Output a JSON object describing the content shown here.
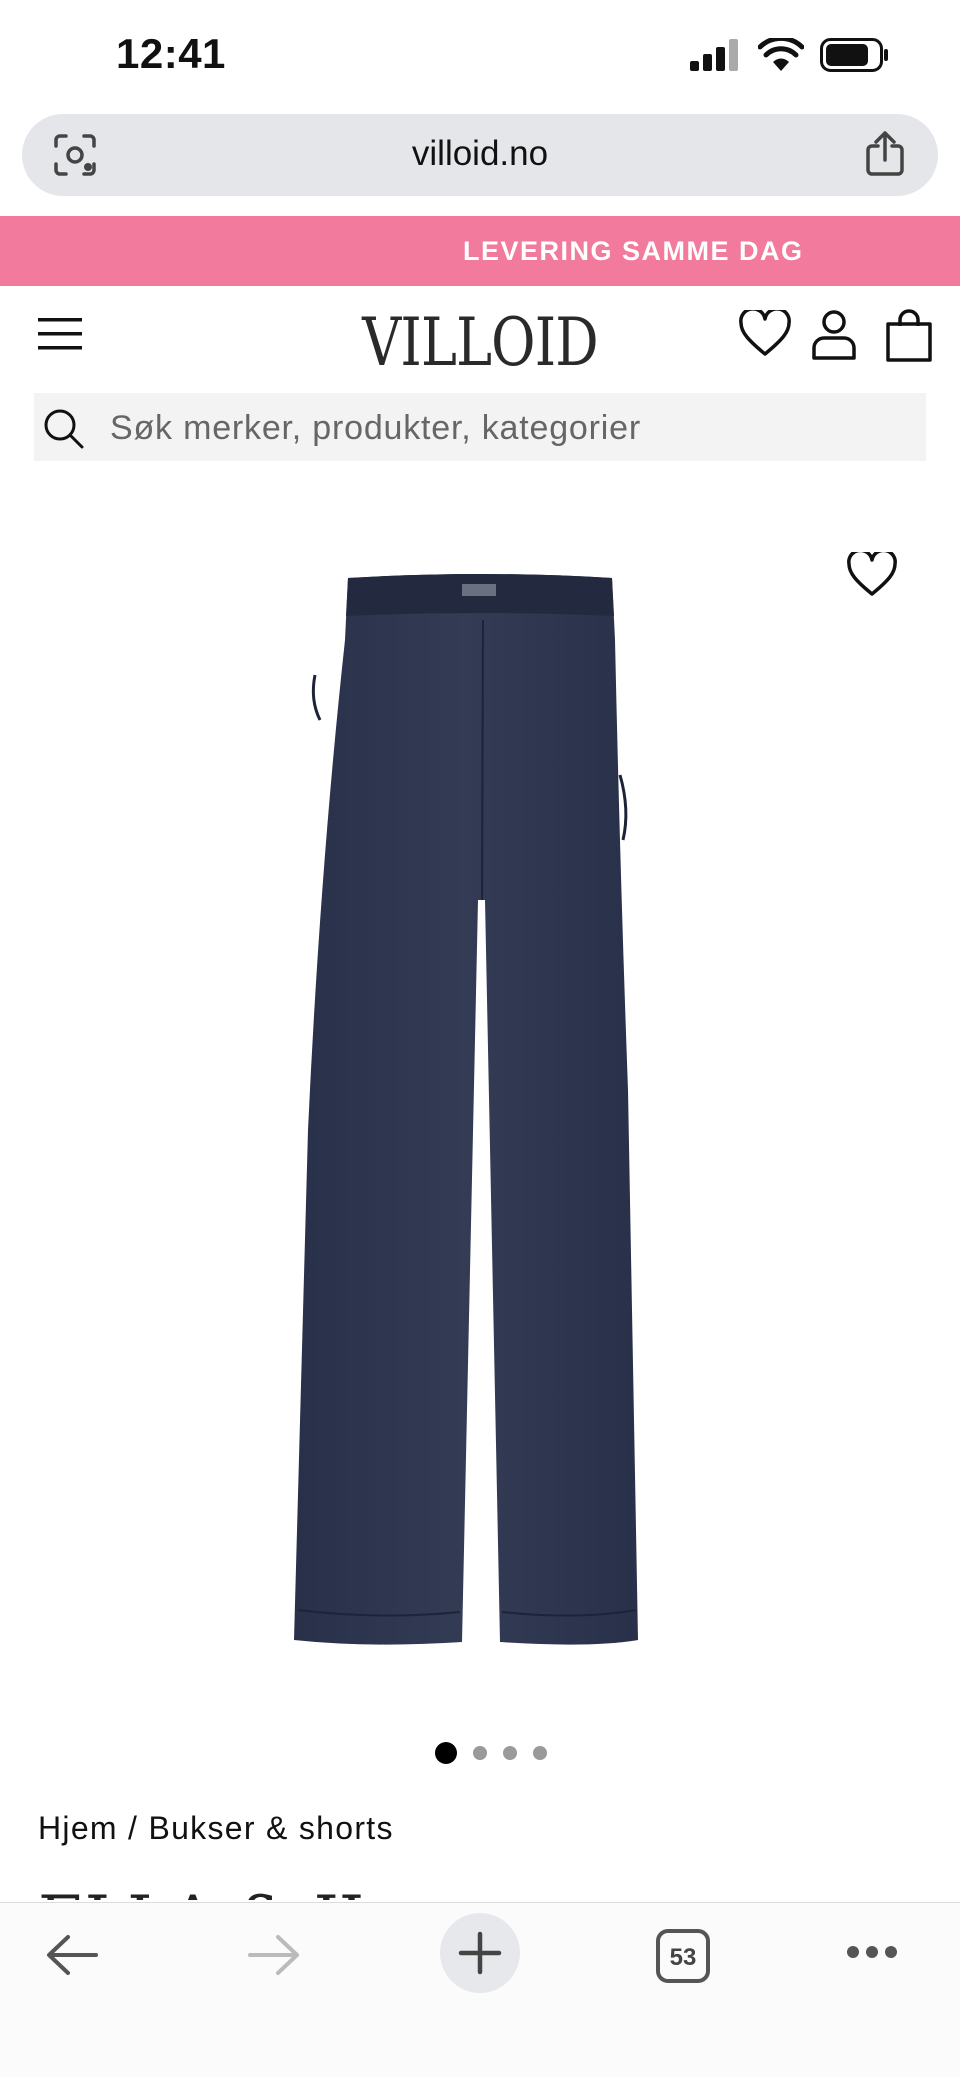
{
  "status_bar": {
    "time": "12:41"
  },
  "browser": {
    "url": "villoid.no",
    "tab_count": "53"
  },
  "promo": {
    "text": "LEVERING SAMME DAG",
    "color": "#f27a9d"
  },
  "header": {
    "logo": "VILLOID"
  },
  "search": {
    "placeholder": "Søk merker, produkter, kategorier"
  },
  "gallery": {
    "image_count": 4,
    "active_index": 0
  },
  "breadcrumb": {
    "text": "Hjem / Bukser & shorts"
  },
  "product": {
    "title_partial": "ELLA & IL"
  },
  "icons": [
    "signal-icon",
    "wifi-icon",
    "battery-icon",
    "page-tools-icon",
    "share-icon",
    "menu-icon",
    "heart-icon",
    "user-icon",
    "bag-icon",
    "search-icon",
    "favorite-icon",
    "back-icon",
    "forward-icon",
    "plus-icon",
    "tabs-icon",
    "more-icon"
  ]
}
